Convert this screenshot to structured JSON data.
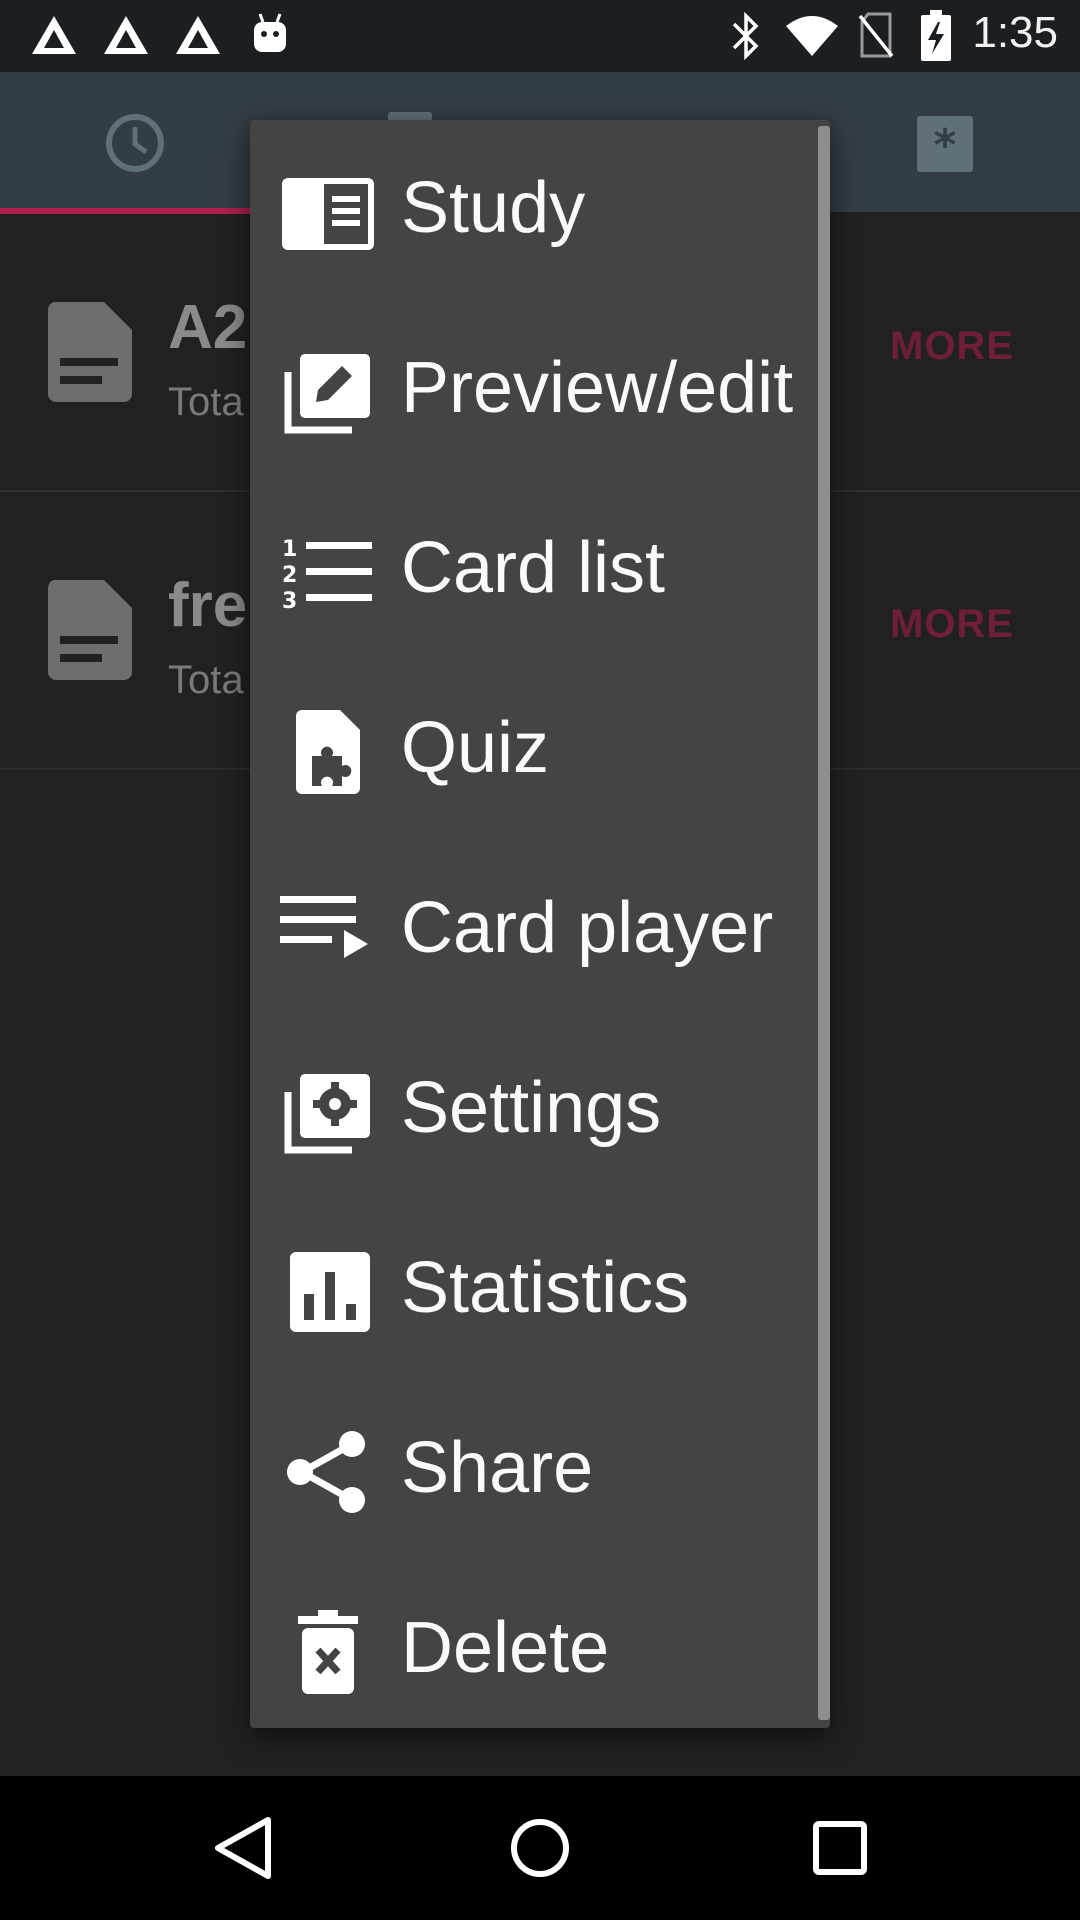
{
  "status_bar": {
    "time": "1:35",
    "left_icons": [
      "notification-triangle-icon",
      "notification-triangle-icon",
      "notification-triangle-icon",
      "android-icon"
    ],
    "right_icons": [
      "bluetooth-icon",
      "wifi-icon",
      "no-sim-icon",
      "battery-charging-icon"
    ]
  },
  "toolbar": {
    "tabs": [
      "clock-icon",
      "deck-tab-icon",
      "asterisk-icon"
    ],
    "accent_color": "#b0204c"
  },
  "decks": [
    {
      "title": "A2",
      "subtitle": "Tota",
      "more_label": "MORE"
    },
    {
      "title": "fre",
      "subtitle": "Tota",
      "more_label": "MORE"
    }
  ],
  "menu": {
    "items": [
      {
        "label": "Study",
        "icon": "study-icon"
      },
      {
        "label": "Preview/edit",
        "icon": "edit-icon"
      },
      {
        "label": "Card list",
        "icon": "numbered-list-icon"
      },
      {
        "label": "Quiz",
        "icon": "quiz-icon"
      },
      {
        "label": "Card player",
        "icon": "playlist-play-icon"
      },
      {
        "label": "Settings",
        "icon": "settings-icon"
      },
      {
        "label": "Statistics",
        "icon": "statistics-icon"
      },
      {
        "label": "Share",
        "icon": "share-icon"
      },
      {
        "label": "Delete",
        "icon": "delete-icon"
      }
    ]
  },
  "nav_bar": {
    "buttons": [
      "back-icon",
      "home-icon",
      "recents-icon"
    ]
  }
}
